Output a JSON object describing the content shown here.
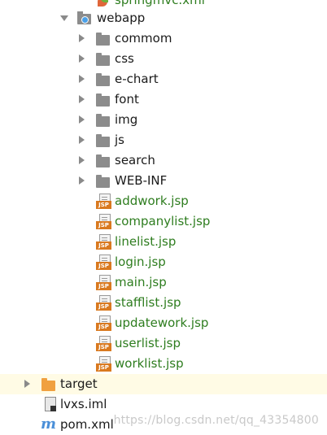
{
  "tree": {
    "top_file": "springmvc.xml",
    "webapp": "webapp",
    "folders": [
      "commom",
      "css",
      "e-chart",
      "font",
      "img",
      "js",
      "search",
      "WEB-INF"
    ],
    "jsp_files": [
      "addwork.jsp",
      "companylist.jsp",
      "linelist.jsp",
      "login.jsp",
      "main.jsp",
      "stafflist.jsp",
      "updatework.jsp",
      "userlist.jsp",
      "worklist.jsp"
    ],
    "target": "target",
    "iml": "lvxs.iml",
    "pom": "pom.xml"
  },
  "watermark": "https://blog.csdn.net/qq_43354800",
  "colors": {
    "jsp_text": "#2e7d1f",
    "highlight_row": "#fffbe5",
    "target_folder": "#f0a040"
  },
  "icons": {
    "maven": "m"
  }
}
